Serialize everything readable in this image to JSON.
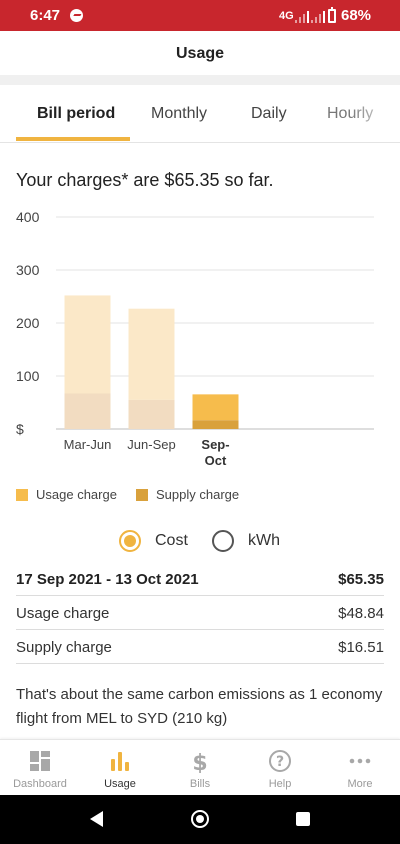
{
  "status_bar": {
    "time": "6:47",
    "network": "4G",
    "battery": "68%"
  },
  "header": {
    "title": "Usage"
  },
  "tabs": [
    {
      "label": "Bill period",
      "active": true
    },
    {
      "label": "Monthly",
      "active": false
    },
    {
      "label": "Daily",
      "active": false
    },
    {
      "label": "Hourly",
      "active": false
    }
  ],
  "summary": "Your charges* are $65.35 so far.",
  "legend": {
    "usage": "Usage charge",
    "supply": "Supply charge"
  },
  "colors": {
    "accent": "#f0b440",
    "usage_current": "#f6bc4c",
    "supply_current": "#d9a13c",
    "usage_past": "#fbe8c8",
    "supply_past": "#f2dcc1",
    "status_bar": "#c8262d"
  },
  "chart_data": {
    "type": "bar",
    "stacked": true,
    "categories": [
      "Mar-Jun",
      "Jun-Sep",
      "Sep-Oct"
    ],
    "category_display": [
      [
        "Mar-Jun"
      ],
      [
        "Jun-Sep"
      ],
      [
        "Sep-",
        "Oct"
      ]
    ],
    "highlighted_category": "Sep-Oct",
    "series": [
      {
        "name": "Supply charge",
        "values": [
          67,
          55,
          16.51
        ]
      },
      {
        "name": "Usage charge",
        "values": [
          185,
          172,
          48.84
        ]
      }
    ],
    "yticks": [
      0,
      100,
      200,
      300,
      400
    ],
    "ytick_labels": [
      "$",
      "100",
      "200",
      "300",
      "400"
    ],
    "ylim": [
      0,
      400
    ],
    "xlabel": "",
    "ylabel": "",
    "grid": true
  },
  "toggle": {
    "cost_label": "Cost",
    "kwh_label": "kWh",
    "selected": "cost"
  },
  "details": {
    "period": "17 Sep 2021 - 13 Oct 2021",
    "total": "$65.35",
    "rows": [
      {
        "label": "Usage charge",
        "value": "$48.84"
      },
      {
        "label": "Supply charge",
        "value": "$16.51"
      }
    ]
  },
  "carbon_text": "That's about the same carbon emissions as 1 economy flight from MEL to SYD (210 kg)",
  "bottom_nav": [
    {
      "label": "Dashboard",
      "icon": "dashboard-icon",
      "active": false
    },
    {
      "label": "Usage",
      "icon": "bar-chart-icon",
      "active": true
    },
    {
      "label": "Bills",
      "icon": "dollar-icon",
      "active": false
    },
    {
      "label": "Help",
      "icon": "help-icon",
      "active": false
    },
    {
      "label": "More",
      "icon": "more-icon",
      "active": false
    }
  ]
}
